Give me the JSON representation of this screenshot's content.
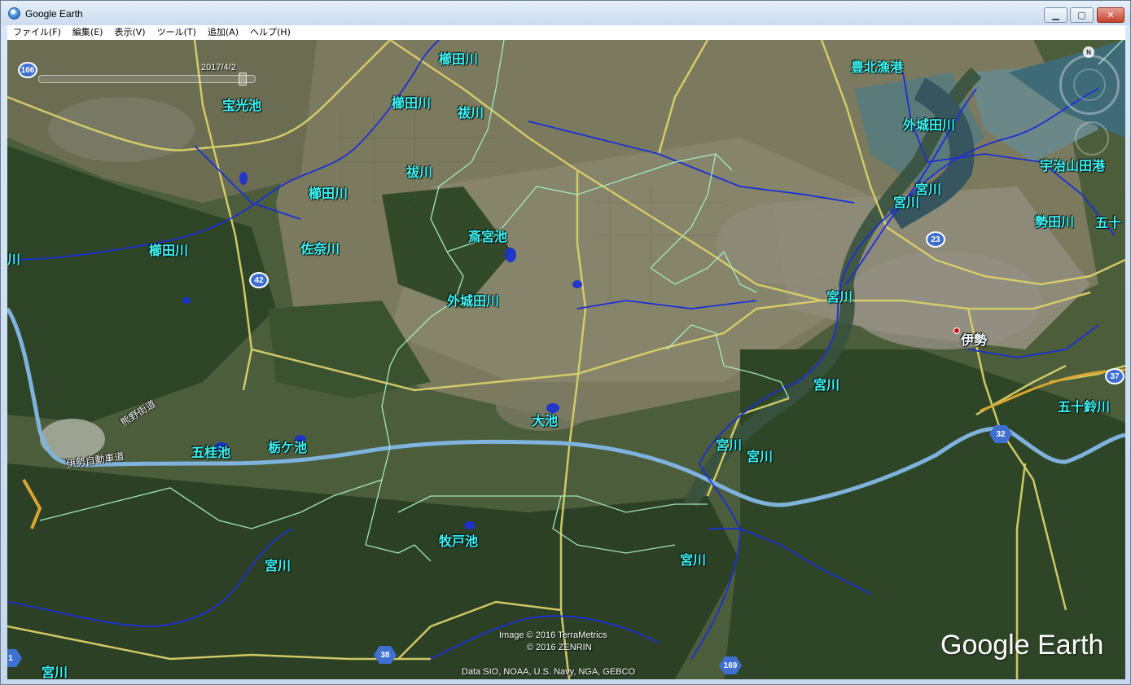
{
  "window": {
    "title": "Google Earth",
    "minimize_glyph": "▁",
    "maximize_glyph": "▢",
    "close_glyph": "✕"
  },
  "menu": [
    "ファイル(F)",
    "編集(E)",
    "表示(V)",
    "ツール(T)",
    "追加(A)",
    "ヘルプ(H)"
  ],
  "timeline": {
    "date": "2017/4/2",
    "position": 0.96
  },
  "navigation": {
    "north_label": "N"
  },
  "labels": [
    "櫛田川",
    "櫛田川",
    "祓川",
    "豊北漁港",
    "宝光池",
    "外城田川",
    "祓川",
    "宇治山田港",
    "櫛田川",
    "宮川",
    "宮川",
    "勢田川",
    "五十",
    "斎宮池",
    "櫛田川",
    "佐奈川",
    "川",
    "宮川",
    "外城田川",
    "宮川",
    "五十鈴川",
    "大池",
    "五桂池",
    "栃ケ池",
    "宮川",
    "宮川",
    "牧戸池",
    "宮川",
    "宮川",
    "宮川"
  ],
  "city_label": "伊勢",
  "road_labels": [
    "熊野街道",
    "伊勢自動車道"
  ],
  "shields": [
    "166",
    "42",
    "23",
    "37",
    "32",
    "38",
    "169",
    "1"
  ],
  "attribution": {
    "imagery": "Image © 2016 TerraMetrics",
    "copyright": "© 2016 ZENRIN",
    "data": "Data SIO, NOAA, U.S. Navy, NGA, GEBCO",
    "logo": "Google Earth"
  },
  "colors": {
    "label": "#3ff2f2",
    "river": "#1a2fd6",
    "road": "#d8cf6a",
    "expressway": "#7fb2dc",
    "boundary": "#a8f0c8"
  }
}
